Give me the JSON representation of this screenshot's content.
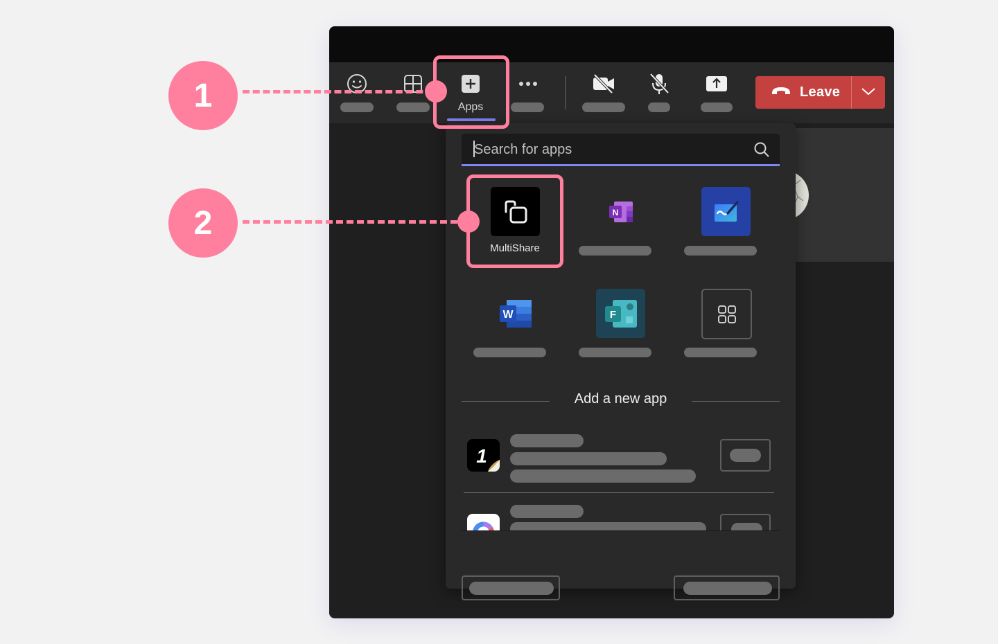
{
  "annotations": [
    {
      "number": "1",
      "target": "apps-button"
    },
    {
      "number": "2",
      "target": "multishare-app"
    }
  ],
  "toolbar": {
    "items": [
      {
        "icon": "emoji-icon",
        "label_placeholder": true
      },
      {
        "icon": "layout-grid-icon",
        "label_placeholder": true
      },
      {
        "icon": "apps-plus-icon",
        "label": "Apps",
        "active": true
      },
      {
        "icon": "more-icon",
        "label_placeholder": true
      },
      {
        "icon": "camera-off-icon",
        "label_placeholder": true
      },
      {
        "icon": "mic-off-icon",
        "label_placeholder": true
      },
      {
        "icon": "share-screen-icon",
        "label_placeholder": true
      }
    ],
    "apps_label": "Apps",
    "leave": {
      "label": "Leave",
      "color": "#c4413f"
    }
  },
  "apps_panel": {
    "search": {
      "placeholder": "Search for apps",
      "value": ""
    },
    "apps": [
      {
        "name": "MultiShare",
        "icon": "multishare-icon",
        "highlighted": true
      },
      {
        "name": "",
        "icon": "onenote-icon"
      },
      {
        "name": "",
        "icon": "whiteboard-icon"
      },
      {
        "name": "",
        "icon": "word-icon"
      },
      {
        "name": "",
        "icon": "forms-icon"
      },
      {
        "name": "",
        "icon": "more-apps-icon"
      }
    ],
    "add_section_title": "Add a new app",
    "new_apps": [
      {
        "icon": "1password-icon"
      },
      {
        "icon": "chart-app-icon"
      }
    ]
  },
  "colors": {
    "accent": "#7f85f5",
    "annotation": "#ff7f9e",
    "leave": "#c4413f",
    "placeholder_bar": "#6b6b6b"
  }
}
